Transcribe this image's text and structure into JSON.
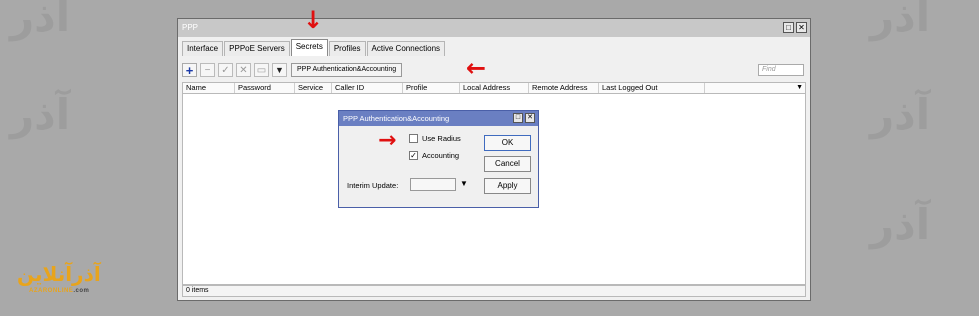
{
  "window": {
    "title": "PPP",
    "maximize_glyph": "□",
    "close_glyph": "✕"
  },
  "tabs": [
    {
      "label": "Interface"
    },
    {
      "label": "PPPoE Servers"
    },
    {
      "label": "Secrets",
      "active": true
    },
    {
      "label": "Profiles"
    },
    {
      "label": "Active Connections"
    }
  ],
  "toolbar": {
    "add_icon": "plus-icon",
    "auth_button_label": "PPP Authentication&Accounting",
    "find_placeholder": "Find"
  },
  "table": {
    "columns": [
      "Name",
      "Password",
      "Service",
      "Caller ID",
      "Profile",
      "Local Address",
      "Remote Address",
      "Last Logged Out"
    ],
    "rows": []
  },
  "status": {
    "items_text": "0 items"
  },
  "dialog": {
    "title": "PPP Authentication&Accounting",
    "use_radius_label": "Use Radius",
    "use_radius_checked": false,
    "accounting_label": "Accounting",
    "accounting_checked": true,
    "interim_update_label": "Interim Update:",
    "interim_update_value": "",
    "ok_label": "OK",
    "cancel_label": "Cancel",
    "apply_label": "Apply"
  },
  "annotations": {
    "arrow_color": "#e01010"
  },
  "logo": {
    "main_text": "آذرآنلاین",
    "sub_brand": "AZAR",
    "sub_rest": "ONLINE",
    "sub_domain": ".com"
  },
  "colors": {
    "background": "#a9a9a9",
    "dialog_title": "#6a7fc2",
    "logo_accent": "#e8a41c"
  }
}
